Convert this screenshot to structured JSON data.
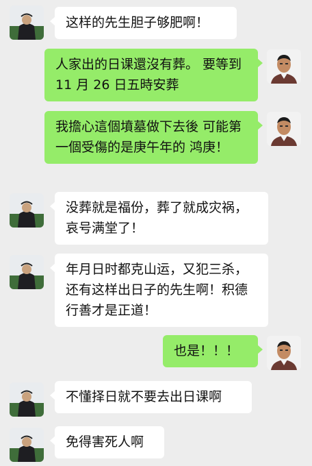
{
  "messages": [
    {
      "side": "left",
      "avatar": "monk-avatar",
      "text": "这样的先生胆子够肥啊！"
    },
    {
      "side": "right",
      "avatar": "man-portrait-avatar",
      "text": "人家出的日课還沒有葬。 要等到 11 月 26 日五時安葬"
    },
    {
      "side": "right",
      "avatar": "man-portrait-avatar",
      "text": "我擔心這個墳墓做下去後 可能第一個受傷的是庚午年的 鸿庚！"
    },
    {
      "side": "left",
      "avatar": "monk-avatar",
      "text": "没葬就是福份，葬了就成灾祸，哀号满堂了！"
    },
    {
      "side": "left",
      "avatar": "monk-avatar",
      "text": "年月日时都克山运，又犯三杀，还有这样出日子的先生啊！积德行善才是正道！"
    },
    {
      "side": "right",
      "avatar": "man-portrait-avatar",
      "text": "也是！！！"
    },
    {
      "side": "left",
      "avatar": "monk-avatar",
      "text": "不懂择日就不要去出日课啊"
    },
    {
      "side": "left",
      "avatar": "monk-avatar",
      "text": "免得害死人啊"
    }
  ],
  "colors": {
    "background": "#ededed",
    "incoming_bubble": "#ffffff",
    "outgoing_bubble": "#95ec69"
  }
}
